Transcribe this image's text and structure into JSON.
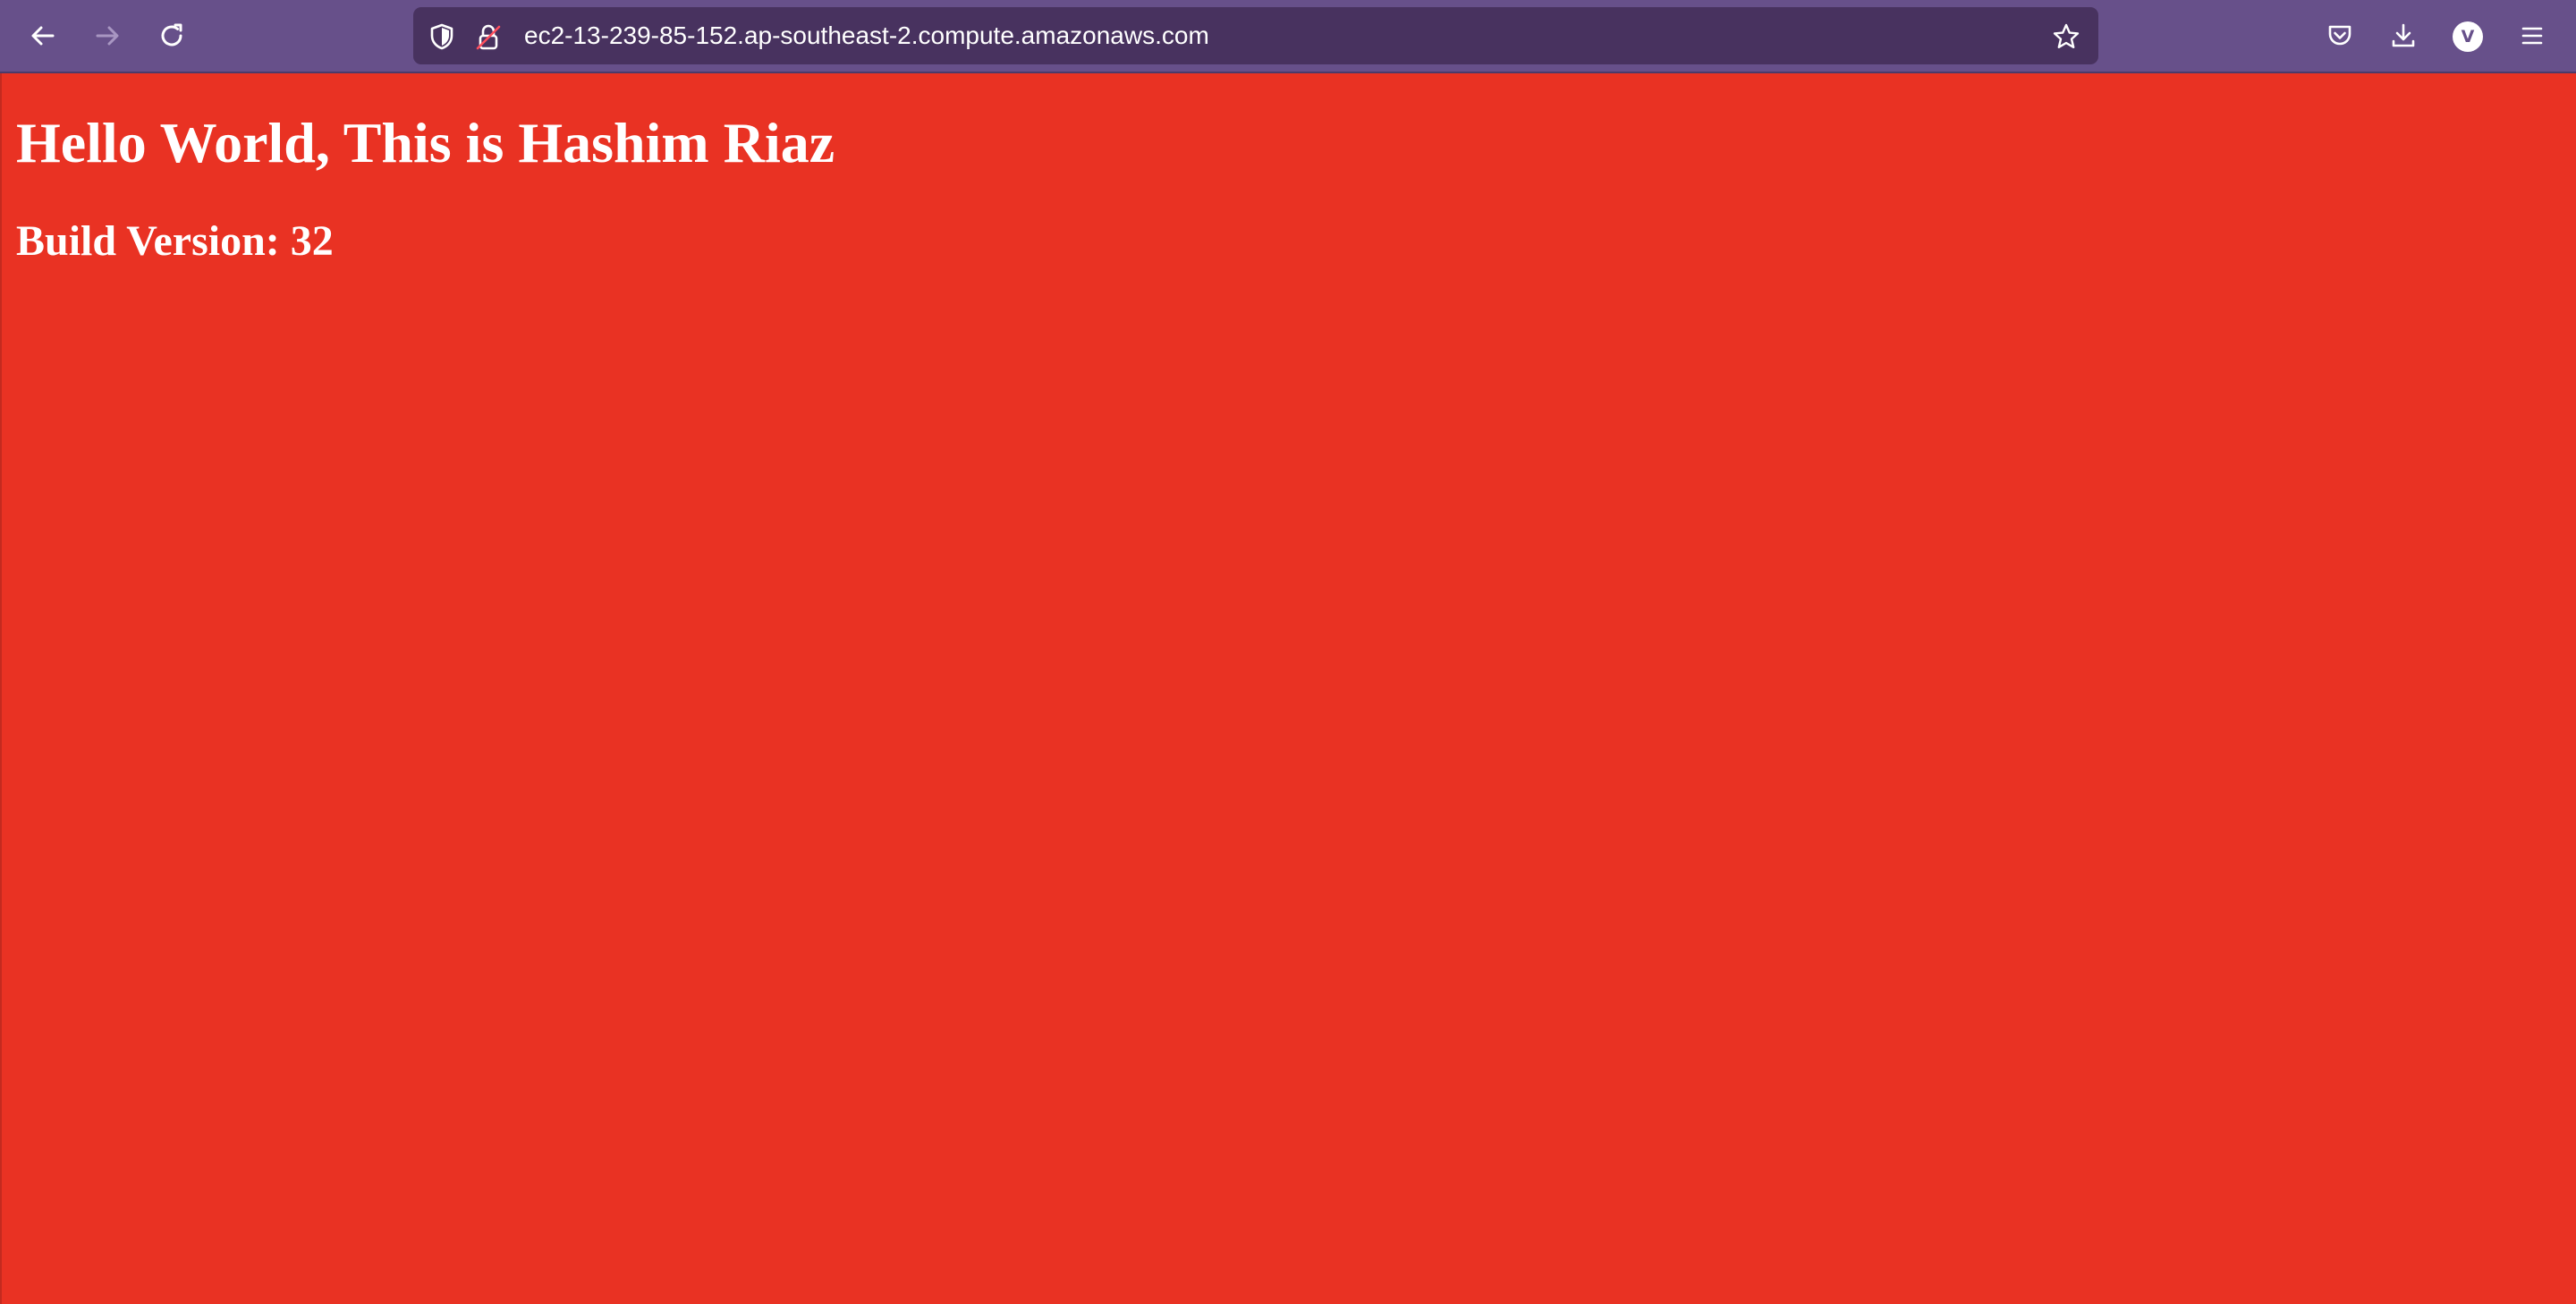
{
  "browser": {
    "url": "ec2-13-239-85-152.ap-southeast-2.compute.amazonaws.com",
    "profile_initial": "V",
    "toolbar_color": "#67508a",
    "urlbar_color": "#48325f",
    "icons": {
      "back": "back-arrow-icon",
      "forward": "forward-arrow-icon",
      "reload": "reload-icon",
      "tracking_protection": "shield-icon",
      "connection": "insecure-lock-icon",
      "bookmark": "star-icon",
      "pocket": "pocket-icon",
      "downloads": "download-icon",
      "menu": "hamburger-menu-icon"
    }
  },
  "page": {
    "heading": "Hello World, This is Hashim Riaz",
    "build_version": "Build Version: 32",
    "background_color": "#e93223",
    "text_color": "#ffffff"
  }
}
